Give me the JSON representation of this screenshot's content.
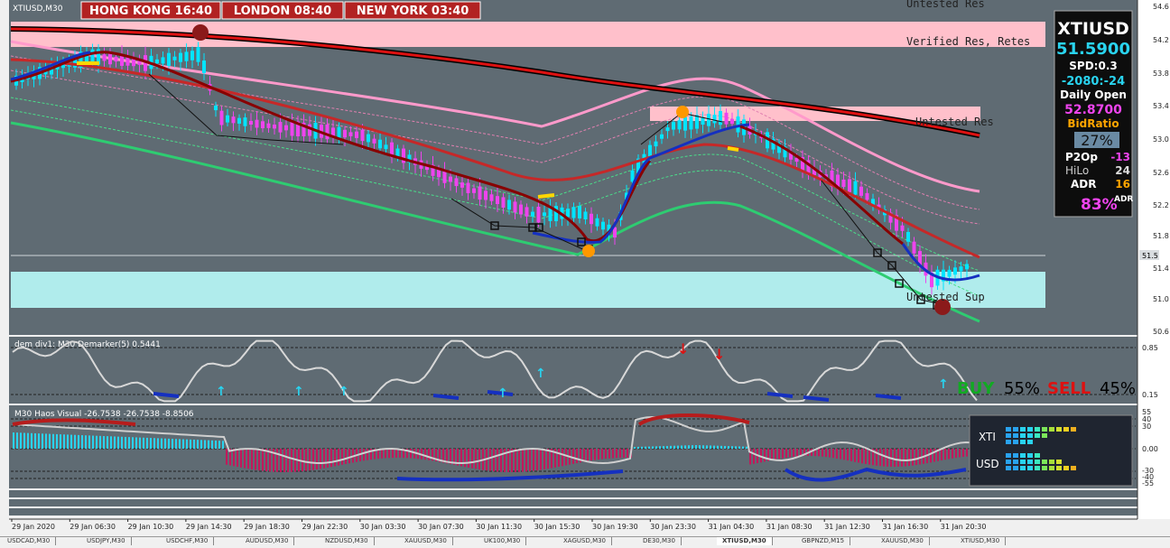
{
  "window": {
    "symbol_label": "XTIUSD,M30"
  },
  "clocks": [
    {
      "label": "HONG KONG 16:40"
    },
    {
      "label": "LONDON 08:40"
    },
    {
      "label": "NEW YORK 03:40"
    }
  ],
  "zones": {
    "res_top": "Untested Res",
    "verified": "Verified Res, Retes",
    "proven": "Untested Res",
    "sup": "Untested Sup"
  },
  "info_panel": {
    "symbol": "XTIUSD",
    "price": "51.5900",
    "spread": "SPD:0.3",
    "countdown": "-2080:-24",
    "daily_open_label": "Daily Open",
    "daily_open": "52.8700",
    "bidratio_label": "BidRatio",
    "bidratio": "27%",
    "p2op_label": "P2Op",
    "p2op": "-13",
    "hilo_label": "HiLo",
    "hilo": "24",
    "adr_label": "ADR",
    "adr": "16",
    "adr_pct": "83%",
    "adr_sup": "ADR"
  },
  "price_axis": [
    "54.6",
    "54.2",
    "53.8",
    "53.4",
    "53.0",
    "52.6",
    "52.2",
    "51.8",
    "51.5",
    "51.4",
    "51.0",
    "50.6"
  ],
  "price_current": "51.5",
  "sub1": {
    "title": "dem div1: M30  Demarker(5) 0.5441",
    "levels": [
      "0.85",
      "0.15"
    ],
    "buy_label": "BUY",
    "buy_pct": "55%",
    "sell_label": "SELL",
    "sell_pct": "45%"
  },
  "sub2": {
    "title": "M30 Haos Visual -26.7538 -26.7538 -8.8506",
    "levels": [
      "55",
      "40",
      "30",
      "0.00",
      "-30",
      "-40",
      "-55"
    ],
    "meter_labels": [
      "XTI",
      "USD"
    ]
  },
  "time_axis": [
    "29 Jan 2020",
    "29 Jan 06:30",
    "29 Jan 10:30",
    "29 Jan 14:30",
    "29 Jan 18:30",
    "29 Jan 22:30",
    "30 Jan 03:30",
    "30 Jan 07:30",
    "30 Jan 11:30",
    "30 Jan 15:30",
    "30 Jan 19:30",
    "30 Jan 23:30",
    "31 Jan 04:30",
    "31 Jan 08:30",
    "31 Jan 12:30",
    "31 Jan 16:30",
    "31 Jan 20:30"
  ],
  "tabs": [
    "USDCAD,M30",
    "USDJPY,M30",
    "USDCHF,M30",
    "AUDUSD,M30",
    "NZDUSD,M30",
    "XAUUSD,M30",
    "UK100,M30",
    "XAGUSD,M30",
    "DE30,M30",
    "XTIUSD,M30",
    "GBPNZD,M15",
    "XAUUSD,M30",
    "XTIUSD,M30"
  ],
  "colors": {
    "chart_bg": "#5f6b73",
    "resistance_zone": "#ffc0cb",
    "support_zone": "#b0ecec",
    "bull": "#00e5ff",
    "bear": "#ee44ee",
    "ma_red": "#cc1111",
    "ma_blue": "#0000cc"
  }
}
